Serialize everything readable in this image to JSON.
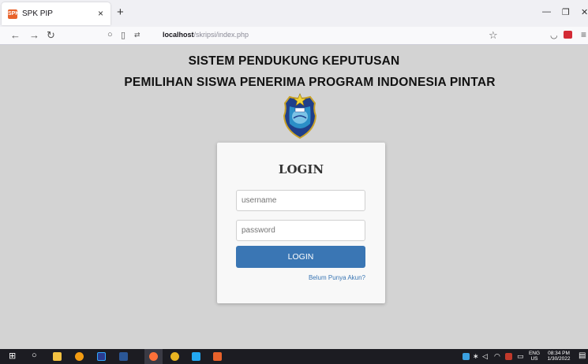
{
  "browser": {
    "tab_title": "SPK PIP",
    "tab_favicon_text": "SPK",
    "url_host": "localhost",
    "url_path": "/skripsi/index.php"
  },
  "page": {
    "title_line1": "SISTEM PENDUKUNG KEPUTUSAN",
    "title_line2": "PEMILIHAN SISWA PENERIMA PROGRAM INDONESIA PINTAR"
  },
  "login": {
    "heading": "LOGIN",
    "username_placeholder": "username",
    "password_placeholder": "password",
    "button_label": "LOGIN",
    "register_link": "Belum Punya Akun?"
  },
  "taskbar": {
    "language": "ENG",
    "region": "US",
    "time": "08:34 PM",
    "date": "1/30/2022"
  },
  "colors": {
    "accent": "#3a76b4",
    "page_background": "#d3d3d3"
  }
}
